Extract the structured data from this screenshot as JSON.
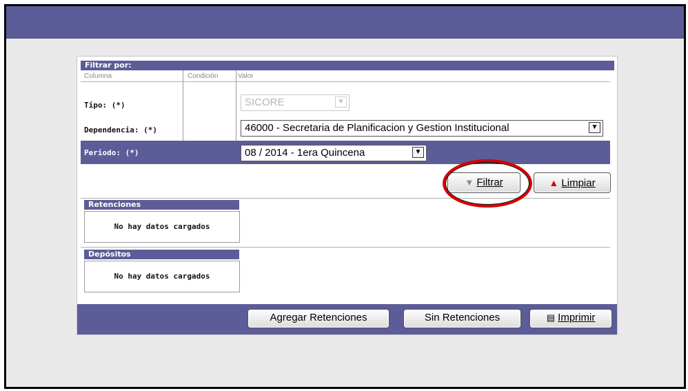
{
  "filter": {
    "header": "Filtrar por:",
    "col_columna": "Columna",
    "col_condicion": "Condición",
    "col_valor": "Valor",
    "tipo_label": "Tipo: (*)",
    "tipo_value": "SICORE",
    "dependencia_label": "Dependencia: (*)",
    "dependencia_value": "46000 - Secretaria de Planificacion y Gestion Institucional",
    "periodo_label": "Periodo: (*)",
    "periodo_value": "08 / 2014 - 1era Quincena",
    "filtrar_label": "Filtrar",
    "limpiar_label": "Limpiar"
  },
  "retenciones": {
    "header": "Retenciones",
    "empty": "No hay datos cargados"
  },
  "depositos": {
    "header": "Depósitos",
    "empty": "No hay datos cargados"
  },
  "footer": {
    "agregar_label": "Agregar Retenciones",
    "sin_label": "Sin Retenciones",
    "imprimir_label": "Imprimir"
  },
  "icons": {
    "filter": "funnel-icon",
    "clear": "broom-icon",
    "print": "printer-icon"
  },
  "colors": {
    "header_bg": "#5c5c98",
    "highlight": "#d60000"
  }
}
